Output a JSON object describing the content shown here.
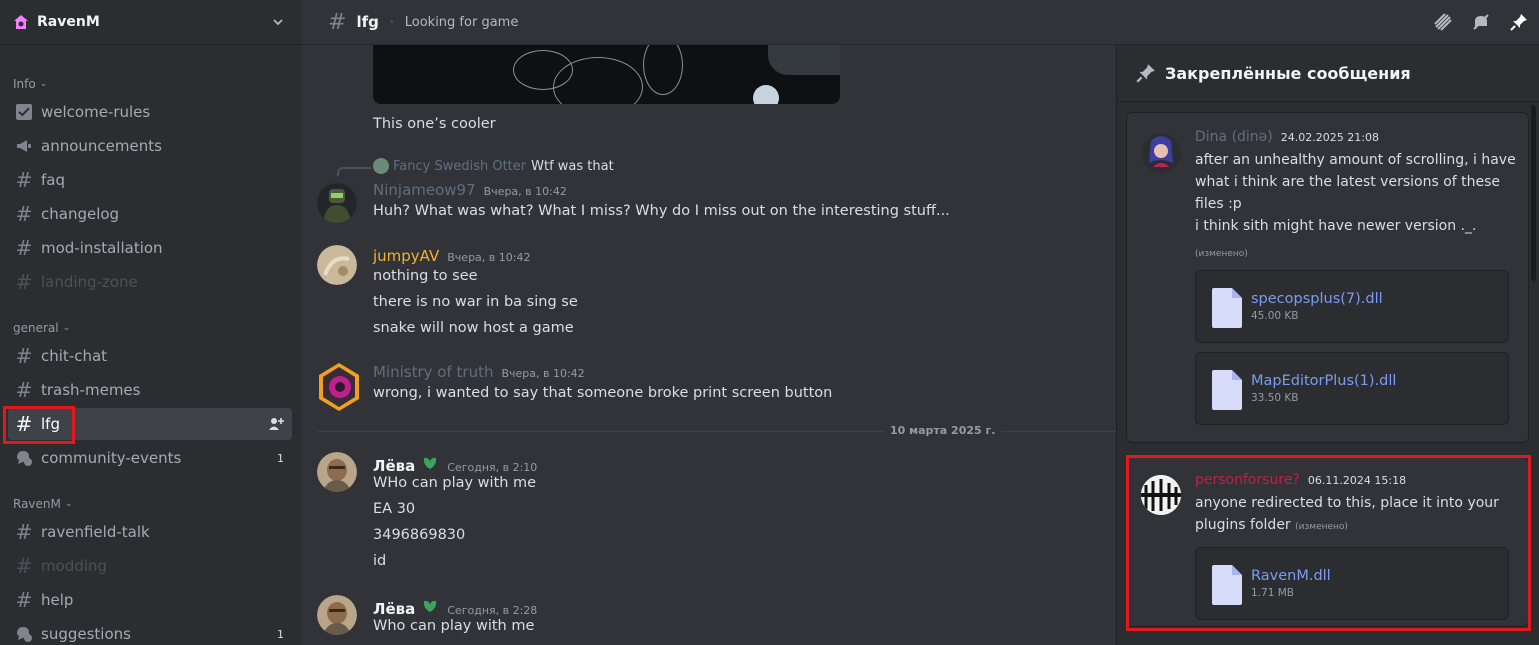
{
  "server": {
    "name": "RavenM"
  },
  "categories": {
    "info": "Info",
    "general": "general",
    "ravenm": "RavenM"
  },
  "channels": {
    "welcome_rules": "welcome-rules",
    "announcements": "announcements",
    "faq": "faq",
    "changelog": "changelog",
    "mod_installation": "mod-installation",
    "landing_zone": "landing-zone",
    "chit_chat": "chit-chat",
    "trash_memes": "trash-memes",
    "lfg": "lfg",
    "community_events": "community-events",
    "community_events_count": "1",
    "ravenfield_talk": "ravenfield-talk",
    "modding": "modding",
    "help": "help",
    "suggestions": "suggestions",
    "suggestions_count": "1"
  },
  "topbar": {
    "channel": "lfg",
    "topic": "Looking for game"
  },
  "chat": {
    "img_caption": "This one’s cooler",
    "reply_author": "Fancy Swedish Otter",
    "reply_text": "Wtf was that",
    "m1_author": "Ninjameow97",
    "m1_time": "Вчера, в 10:42",
    "m1_text": "Huh? What was what? What I miss? Why do I miss out on the interesting stuff...",
    "m2_author": "jumpyAV",
    "m2_time": "Вчера, в 10:42",
    "m2_l1": "nothing to see",
    "m2_l2": "there is no war in ba sing se",
    "m2_l3": "snake will now host a game",
    "m3_author": "Ministry of truth",
    "m3_time": "Вчера, в 10:42",
    "m3_text": "wrong, i wanted to say that someone broke print screen button",
    "date_divider": "10 марта 2025 г.",
    "m4_author": "Лёва",
    "m4_time": "Сегодня, в 2:10",
    "m4_l1": "WHo can play with me",
    "m4_l2": "EA 30",
    "m4_l3": "3496869830",
    "m4_l4": "id",
    "m5_author": "Лёва",
    "m5_time": "Сегодня, в 2:28",
    "m5_l1": "Who can play with me"
  },
  "pinned": {
    "title": "Закреплённые сообщения",
    "p1_author": "Dina (dinə)",
    "p1_time": "24.02.2025 21:08",
    "p1_l1": "after an unhealthy amount of scrolling, i have",
    "p1_l2": "what i think are the latest versions of these",
    "p1_l3": "files :p",
    "p1_l4": "i think sith might have newer version ._.",
    "p1_edited": "(изменено)",
    "p1_file1_name": "specopsplus(7).dll",
    "p1_file1_size": "45.00 KB",
    "p1_file2_name": "MapEditorPlus(1).dll",
    "p1_file2_size": "33.50 KB",
    "p2_author": "personforsure?",
    "p2_time": "06.11.2024 15:18",
    "p2_l1": "anyone redirected to this, place it into your",
    "p2_l2": "plugins folder",
    "p2_edited": "(изменено)",
    "p2_file_name": "RavenM.dll",
    "p2_file_size": "1.71 MB"
  },
  "colors": {
    "accent_yellow": "#f0b232",
    "link_blue": "#7b9cf0",
    "muted_author": "#5f6f80",
    "red_author": "#c02045",
    "highlight_red": "#e0191f"
  }
}
